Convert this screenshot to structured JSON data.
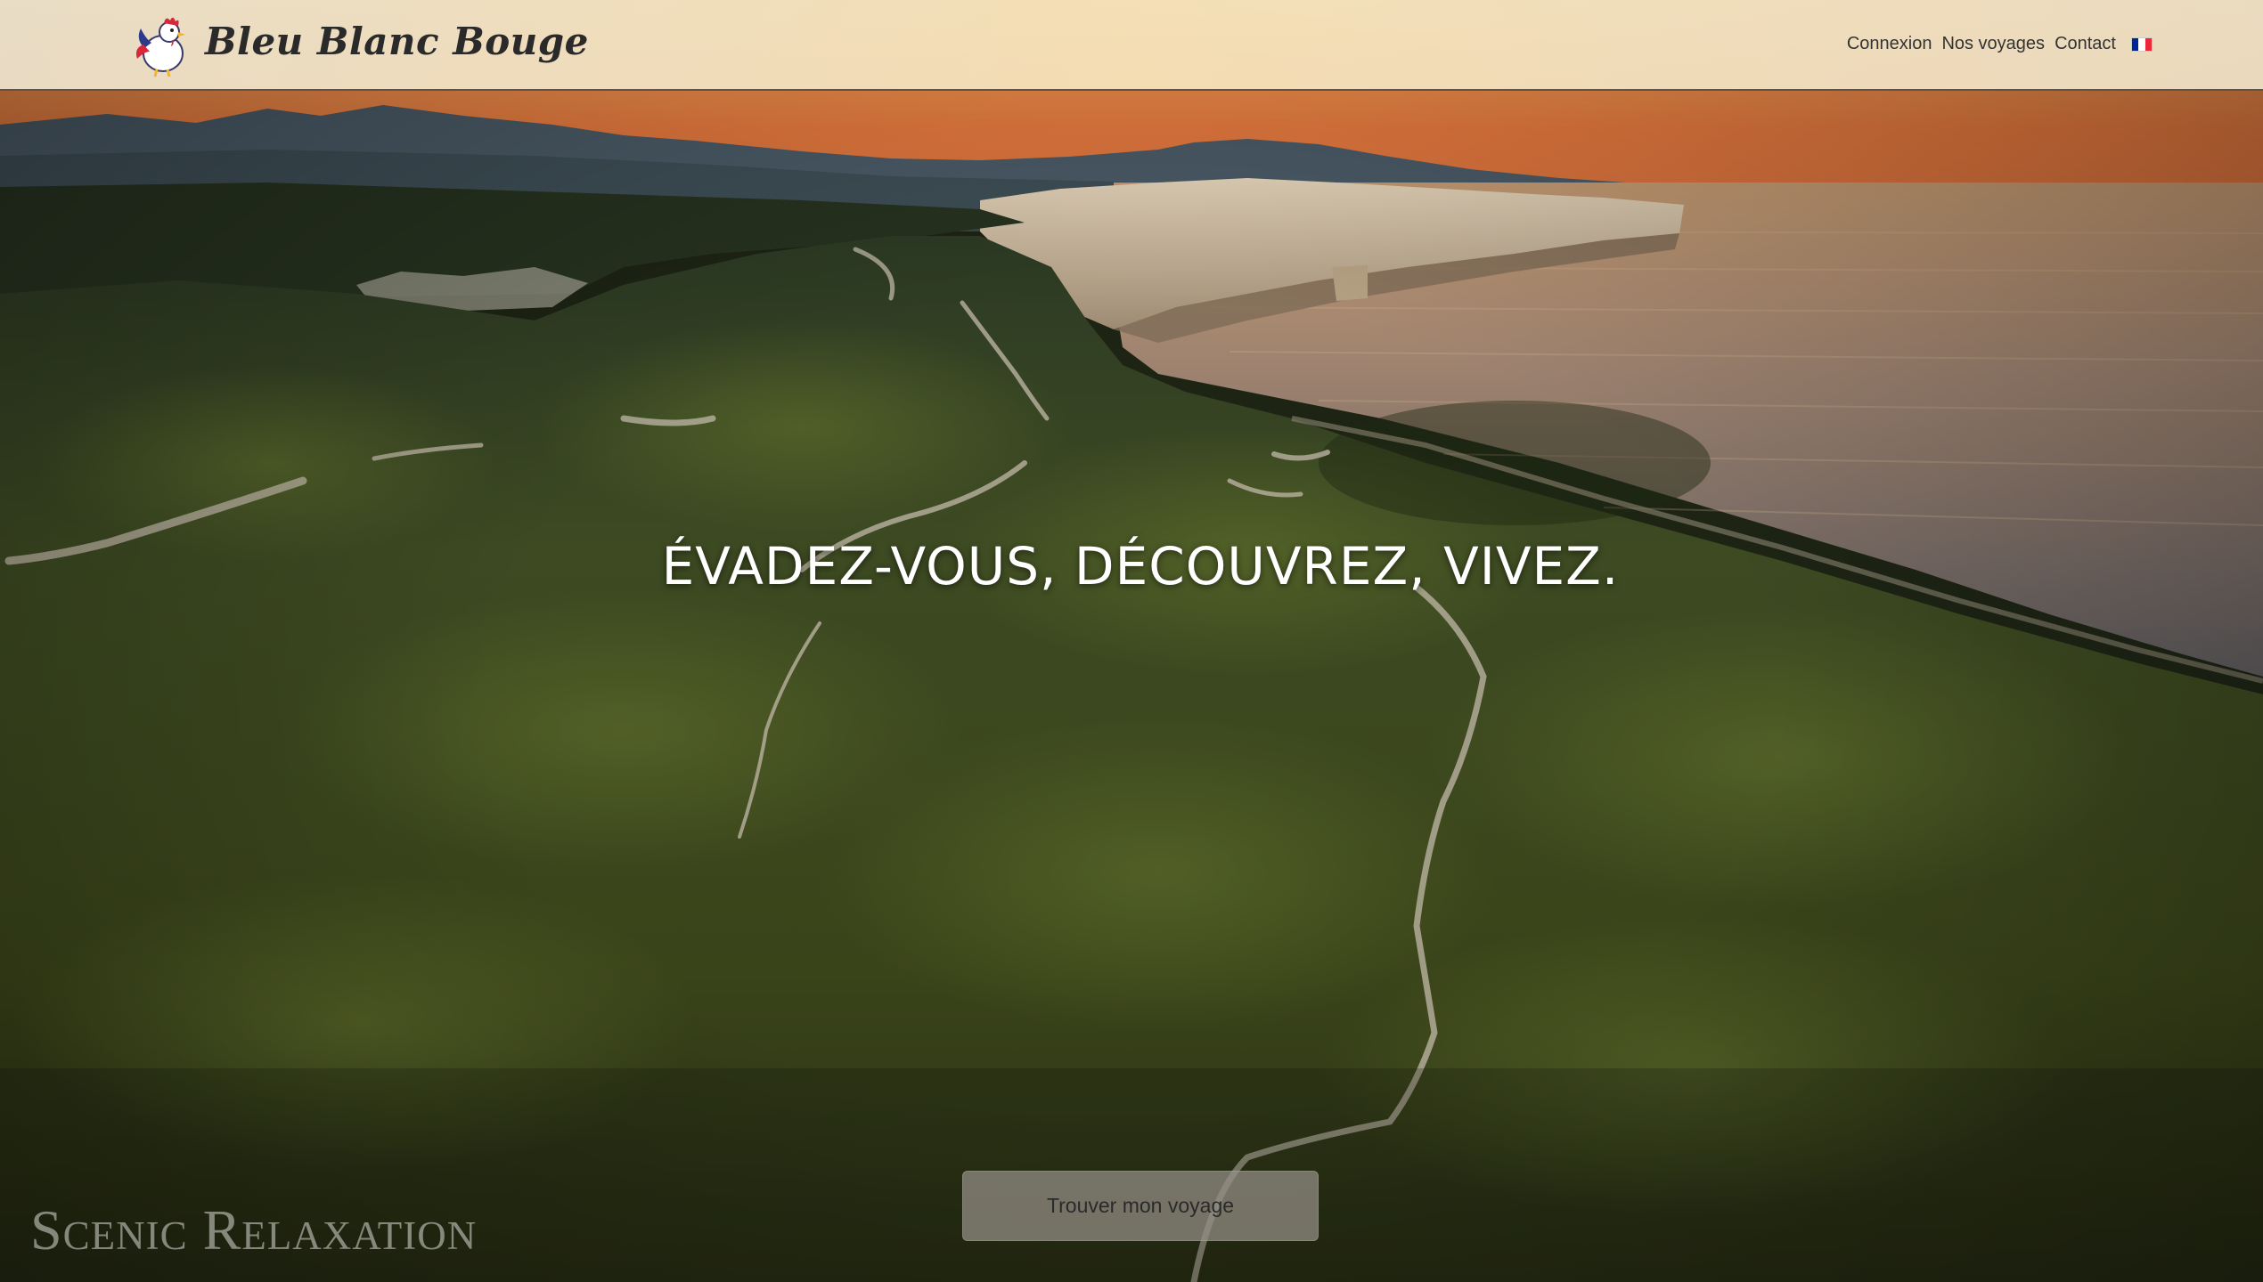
{
  "header": {
    "brand": "Bleu Blanc Bouge",
    "logo_icon": "rooster-logo-icon",
    "nav": [
      {
        "label": "Connexion"
      },
      {
        "label": "Nos voyages"
      },
      {
        "label": "Contact"
      }
    ],
    "language_flag": {
      "icon": "french-flag-icon",
      "colors": [
        "#002395",
        "#ffffff",
        "#ed2939"
      ]
    }
  },
  "hero": {
    "headline": "ÉVADEZ-VOUS, DÉCOUVREZ, VIVEZ.",
    "cta_label": "Trouver mon voyage",
    "watermark": "Scenic Relaxation"
  },
  "colors": {
    "header_bg": "#f3e2c4",
    "sky_top": "#e77b3f",
    "sea": "#8a7a6a",
    "vegetation": "#3f4a20",
    "cta_bg": "#969088"
  }
}
